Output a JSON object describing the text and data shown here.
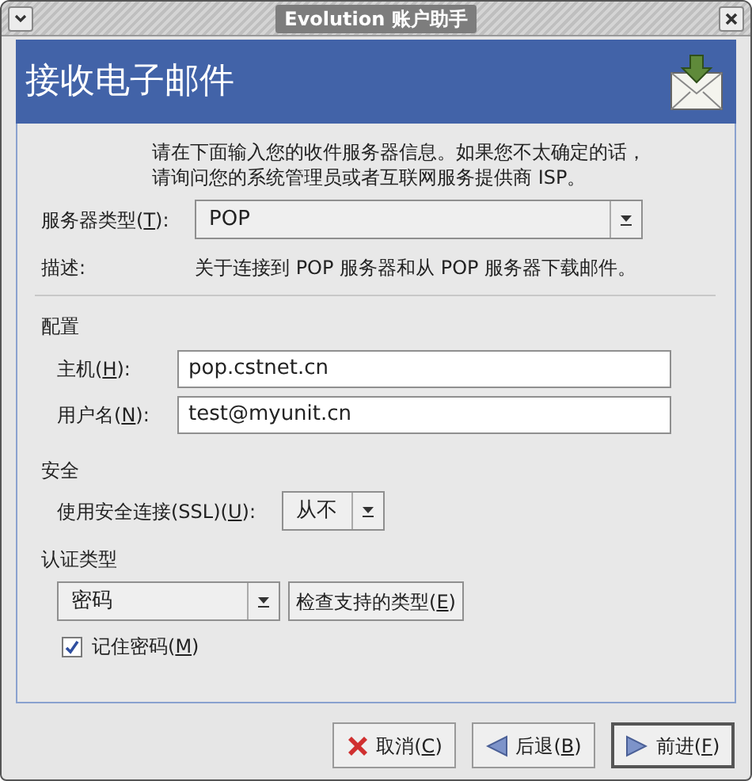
{
  "window": {
    "title": "Evolution 账户助手"
  },
  "header": {
    "title": "接收电子邮件"
  },
  "intro": [
    "请在下面输入您的收件服务器信息。如果您不太确定的话，",
    "请询问您的系统管理员或者互联网服务提供商 ISP。"
  ],
  "server_type": {
    "label": {
      "pre": "服务器类型(",
      "key": "T",
      "post": "):"
    },
    "value": "POP"
  },
  "description": {
    "label": "描述:",
    "text": "关于连接到 POP 服务器和从 POP 服务器下载邮件。"
  },
  "configuration": {
    "title": "配置",
    "fields": [
      {
        "label": {
          "pre": "主机(",
          "key": "H",
          "post": "):"
        },
        "value": "pop.cstnet.cn"
      },
      {
        "label": {
          "pre": "用户名(",
          "key": "N",
          "post": "):"
        },
        "value": "test@myunit.cn"
      }
    ]
  },
  "security": {
    "title": "安全",
    "ssl": {
      "label": {
        "pre": "使用安全连接(SSL)(",
        "key": "U",
        "post": "):"
      },
      "value": "从不"
    }
  },
  "authentication": {
    "title": "认证类型",
    "type": "密码",
    "check_button": {
      "pre": "检查支持的类型(",
      "key": "E",
      "post": ")"
    },
    "remember": {
      "label": {
        "pre": "记住密码(",
        "key": "M",
        "post": ")"
      },
      "checked": true
    }
  },
  "buttons": [
    {
      "kind": "cancel",
      "label": {
        "pre": "取消(",
        "key": "C",
        "post": ")"
      },
      "default": false
    },
    {
      "kind": "back",
      "label": {
        "pre": "后退(",
        "key": "B",
        "post": ")"
      },
      "default": false
    },
    {
      "kind": "forward",
      "label": {
        "pre": "前进(",
        "key": "F",
        "post": ")"
      },
      "default": true
    }
  ]
}
